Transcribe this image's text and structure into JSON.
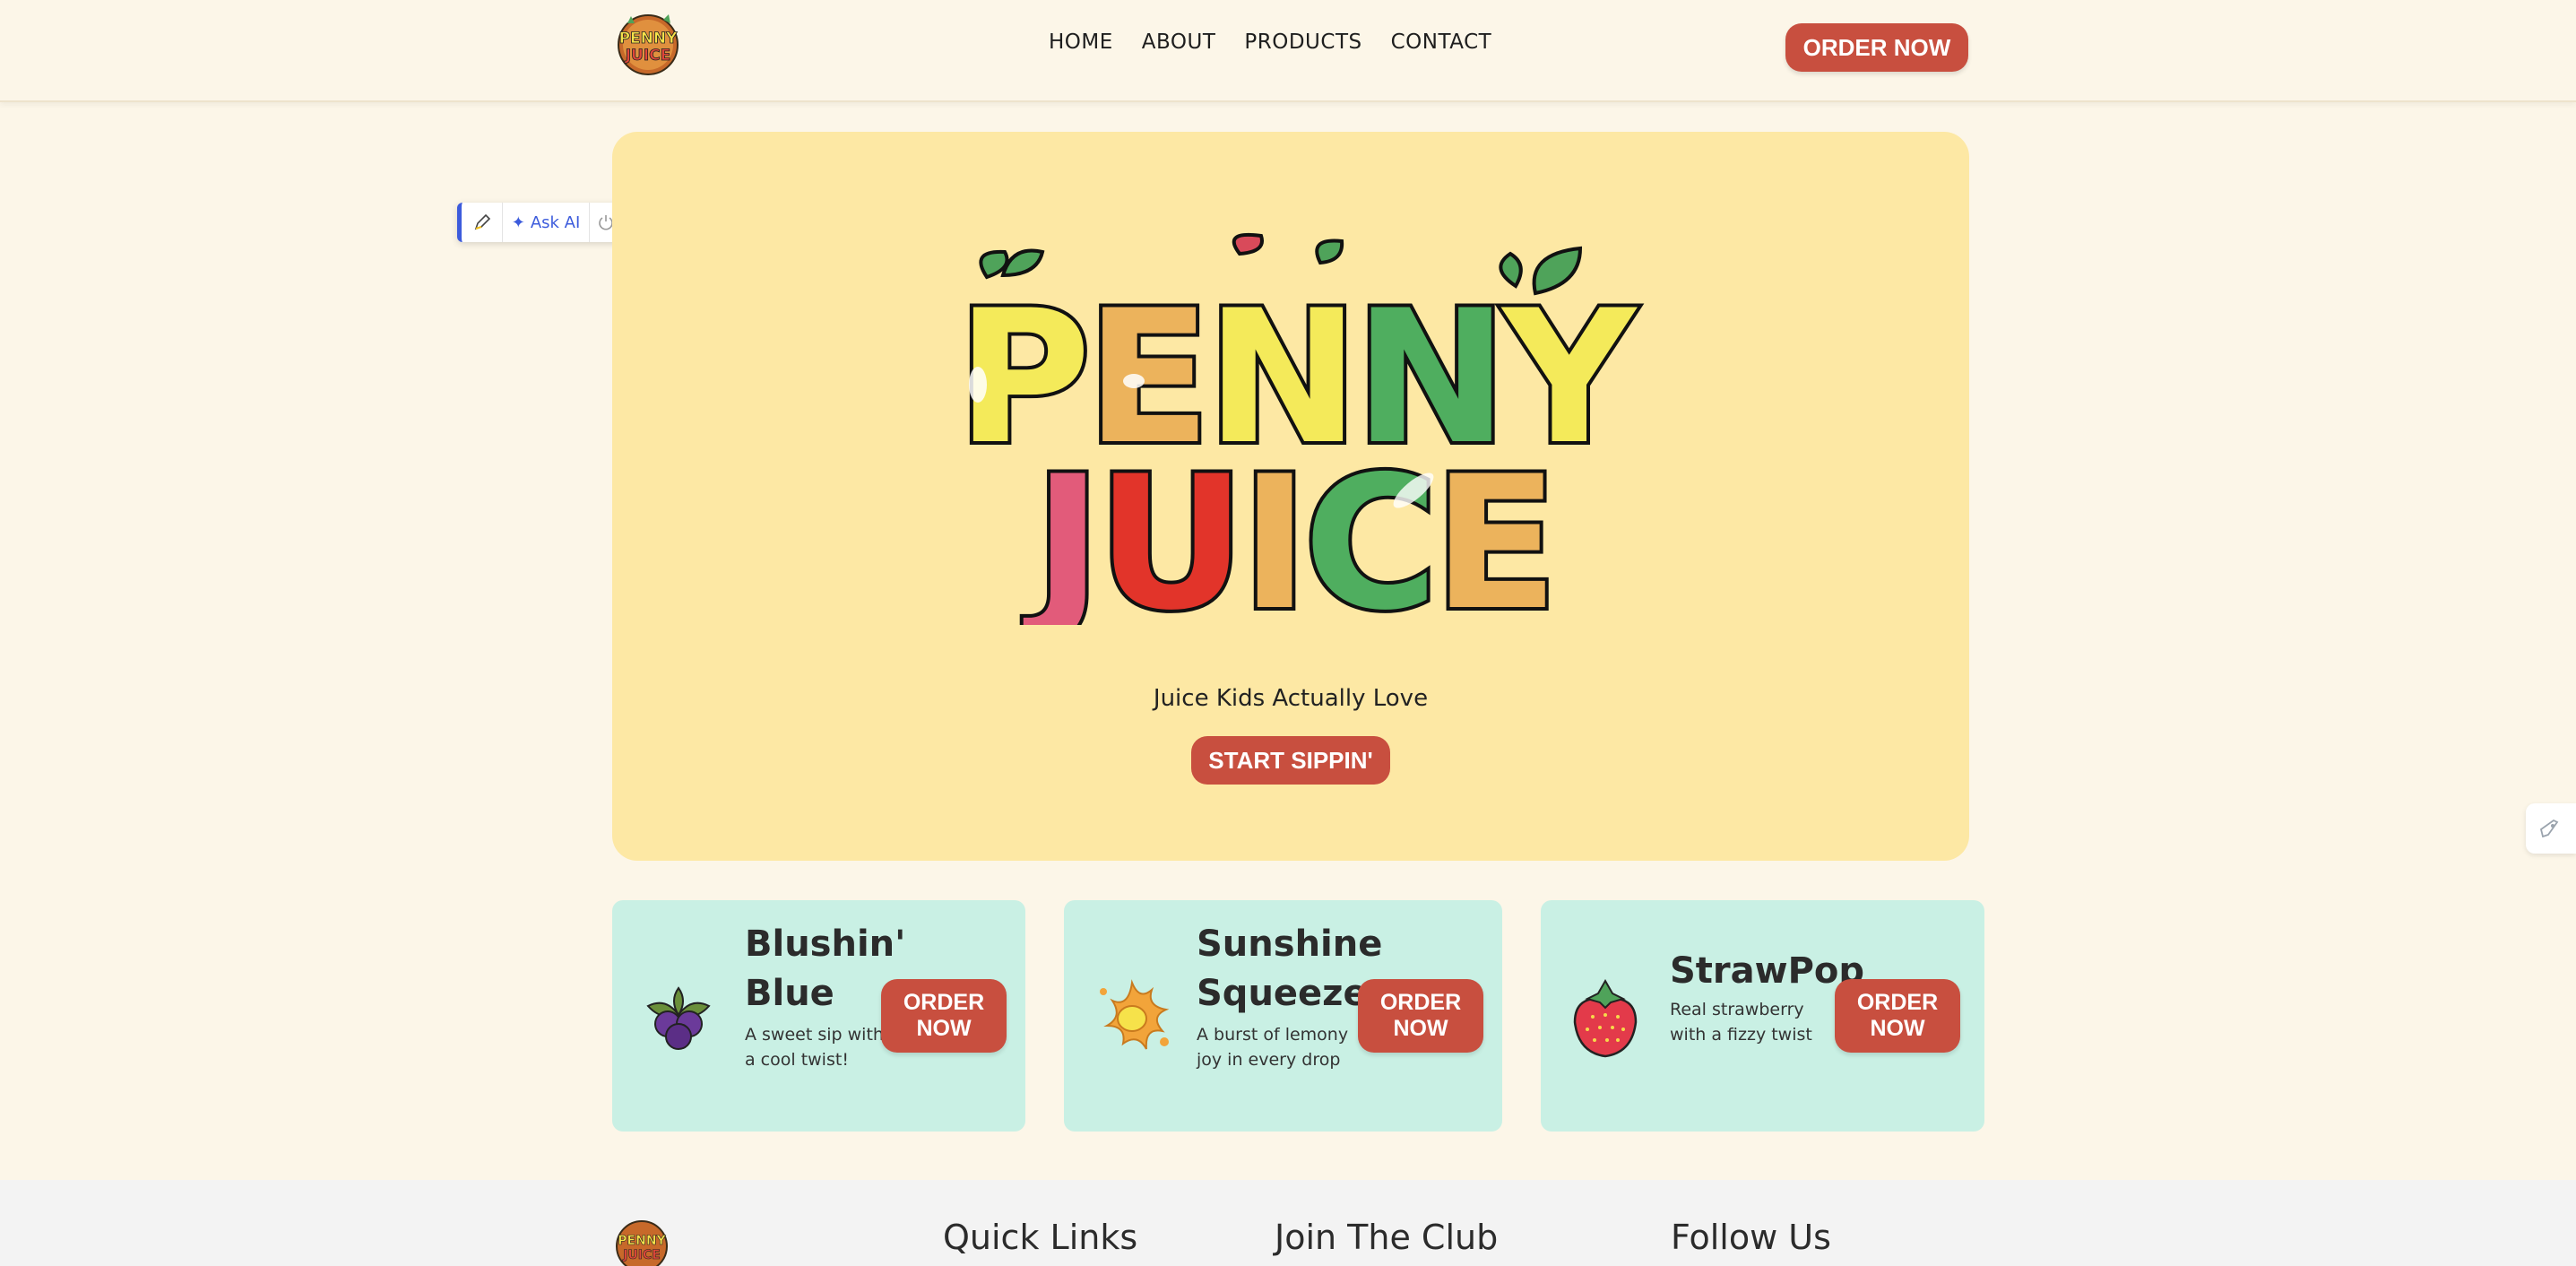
{
  "brand": {
    "name": "Penny Juice",
    "logo_line1": "PENNY",
    "logo_line2": "JUICE"
  },
  "nav": {
    "items": [
      {
        "label": "HOME"
      },
      {
        "label": "ABOUT"
      },
      {
        "label": "PRODUCTS"
      },
      {
        "label": "CONTACT"
      }
    ],
    "order_label": "ORDER NOW"
  },
  "toolbar": {
    "pencil_icon": "pencil-icon",
    "ask_label": "Ask AI",
    "power_icon": "power-icon"
  },
  "hero": {
    "tagline": "Juice Kids Actually Love",
    "cta_label": "START SIPPIN'"
  },
  "products": [
    {
      "title_line1": "Blushin'",
      "title_line2": "Blue",
      "desc_line1": "A sweet sip with",
      "desc_line2": "a cool twist!",
      "button_line1": "ORDER",
      "button_line2": "NOW",
      "icon": "blueberry-icon"
    },
    {
      "title_line1": "Sunshine",
      "title_line2": "Squeeze",
      "desc_line1": "A burst of lemony",
      "desc_line2": "joy in every drop",
      "button_line1": "ORDER",
      "button_line2": "NOW",
      "icon": "lemon-splash-icon"
    },
    {
      "title_line1": "StrawPop",
      "title_line2": "",
      "desc_line1": "Real strawberry",
      "desc_line2": "with a fizzy twist",
      "button_line1": "ORDER",
      "button_line2": "NOW",
      "icon": "strawberry-icon"
    }
  ],
  "footer": {
    "quick_links": "Quick Links",
    "join_club": "Join The Club",
    "follow_us": "Follow Us"
  },
  "colors": {
    "page_bg": "#fcf6e8",
    "hero_bg": "#fde8a4",
    "card_bg": "#c9f0e4",
    "accent": "#c84f3f",
    "footer_bg": "#f3f3f3",
    "toolbar_accent": "#3c5bdc"
  }
}
